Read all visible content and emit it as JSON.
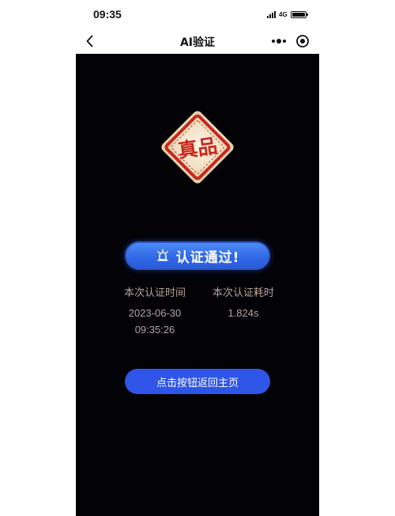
{
  "status_bar": {
    "time": "09:35",
    "network": "4G"
  },
  "nav": {
    "title": "AI验证"
  },
  "stamp": {
    "text": "真品",
    "color": "#c8281e"
  },
  "result": {
    "text": "认证通过!"
  },
  "info": {
    "time_label": "本次认证时间",
    "date": "2023-06-30",
    "time": "09:35:26",
    "duration_label": "本次认证耗时",
    "duration": "1.824s"
  },
  "actions": {
    "home_label": "点击按钮返回主页"
  },
  "colors": {
    "accent": "#2f55e8",
    "background": "#020207"
  }
}
